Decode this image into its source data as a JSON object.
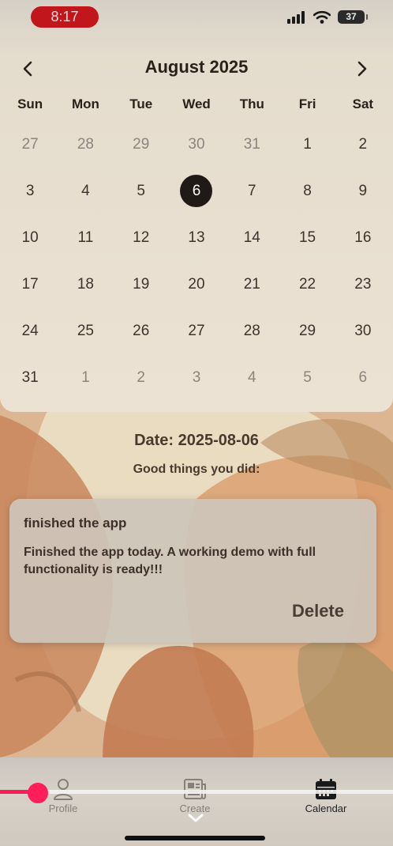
{
  "status_bar": {
    "time": "8:17",
    "battery": "37"
  },
  "calendar": {
    "month_title": "August 2025",
    "weekdays": [
      "Sun",
      "Mon",
      "Tue",
      "Wed",
      "Thu",
      "Fri",
      "Sat"
    ],
    "days": [
      {
        "label": "27",
        "other": true
      },
      {
        "label": "28",
        "other": true
      },
      {
        "label": "29",
        "other": true
      },
      {
        "label": "30",
        "other": true
      },
      {
        "label": "31",
        "other": true
      },
      {
        "label": "1",
        "other": false
      },
      {
        "label": "2",
        "other": false
      },
      {
        "label": "3",
        "other": false
      },
      {
        "label": "4",
        "other": false
      },
      {
        "label": "5",
        "other": false
      },
      {
        "label": "6",
        "other": false,
        "selected": true
      },
      {
        "label": "7",
        "other": false
      },
      {
        "label": "8",
        "other": false
      },
      {
        "label": "9",
        "other": false
      },
      {
        "label": "10",
        "other": false
      },
      {
        "label": "11",
        "other": false
      },
      {
        "label": "12",
        "other": false
      },
      {
        "label": "13",
        "other": false
      },
      {
        "label": "14",
        "other": false
      },
      {
        "label": "15",
        "other": false
      },
      {
        "label": "16",
        "other": false
      },
      {
        "label": "17",
        "other": false
      },
      {
        "label": "18",
        "other": false
      },
      {
        "label": "19",
        "other": false
      },
      {
        "label": "20",
        "other": false
      },
      {
        "label": "21",
        "other": false
      },
      {
        "label": "22",
        "other": false
      },
      {
        "label": "23",
        "other": false
      },
      {
        "label": "24",
        "other": false
      },
      {
        "label": "25",
        "other": false
      },
      {
        "label": "26",
        "other": false
      },
      {
        "label": "27",
        "other": false
      },
      {
        "label": "28",
        "other": false
      },
      {
        "label": "29",
        "other": false
      },
      {
        "label": "30",
        "other": false
      },
      {
        "label": "31",
        "other": false
      },
      {
        "label": "1",
        "other": true
      },
      {
        "label": "2",
        "other": true
      },
      {
        "label": "3",
        "other": true
      },
      {
        "label": "4",
        "other": true
      },
      {
        "label": "5",
        "other": true
      },
      {
        "label": "6",
        "other": true
      }
    ]
  },
  "detail": {
    "date_label": "Date: 2025-08-06",
    "good_things_label": "Good things you did:"
  },
  "entry": {
    "title": "finished the app",
    "body": "Finished the app today. A working demo with full functionality is ready!!!",
    "delete_label": "Delete"
  },
  "nav": {
    "profile_label": "Profile",
    "create_label": "Create",
    "calendar_label": "Calendar"
  },
  "colors": {
    "selected_day": "#201a17",
    "scrubber": "#ff1e5a",
    "time_pill": "#c0161c"
  }
}
